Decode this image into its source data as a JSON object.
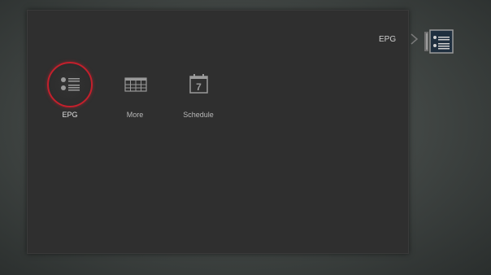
{
  "breadcrumb": {
    "label": "EPG",
    "icon": "epg-list-icon"
  },
  "menu": {
    "items": [
      {
        "label": "EPG",
        "icon": "epg-list-icon",
        "selected": true
      },
      {
        "label": "More",
        "icon": "grid-table-icon",
        "selected": false
      },
      {
        "label": "Schedule",
        "icon": "calendar-icon",
        "selected": false,
        "icon_text": "7"
      }
    ]
  },
  "colors": {
    "panel": "#2f2f2f",
    "focus_ring": "#c3202c",
    "label": "#b8b8b8",
    "icon": "#9a9a9a"
  }
}
